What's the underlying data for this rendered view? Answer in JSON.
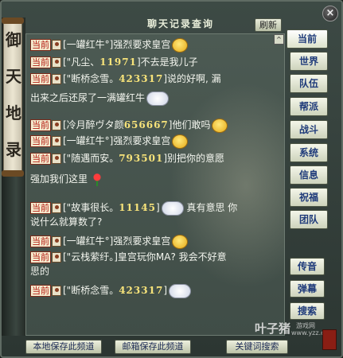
{
  "window": {
    "title": "聊天记录查询",
    "refresh_label": "刷新",
    "close_label": "×"
  },
  "scroll_deco": {
    "glyphs": [
      "御",
      "天",
      "地",
      "录"
    ]
  },
  "chat": {
    "scroll_up_label": "^",
    "messages": [
      {
        "tag": "当前",
        "parts": [
          {
            "t": "text",
            "v": "[一罐红牛°]强烈要求皇宫"
          },
          {
            "t": "emo",
            "v": "face"
          }
        ]
      },
      {
        "tag": "当前",
        "parts": [
          {
            "t": "text",
            "v": "[\"凡尘、"
          },
          {
            "t": "num",
            "v": "11971"
          },
          {
            "t": "text",
            "v": "]不去是我儿子"
          }
        ]
      },
      {
        "tag": "当前",
        "parts": [
          {
            "t": "text",
            "v": "[\"断桥念雪。"
          },
          {
            "t": "num",
            "v": "423317"
          },
          {
            "t": "text",
            "v": "]说的好啊, 漏"
          }
        ]
      },
      {
        "tag": "",
        "parts": [
          {
            "t": "text",
            "v": "出来之后还尿了一满罐红牛"
          },
          {
            "t": "emo",
            "v": "cloud"
          }
        ]
      },
      {
        "tag": "当前",
        "parts": [
          {
            "t": "text",
            "v": "[冷月醉ヴタ颜"
          },
          {
            "t": "num",
            "v": "656667"
          },
          {
            "t": "text",
            "v": "]他们敢吗"
          },
          {
            "t": "emo",
            "v": "face"
          }
        ]
      },
      {
        "tag": "当前",
        "parts": [
          {
            "t": "text",
            "v": "[一罐红牛°]强烈要求皇宫"
          },
          {
            "t": "emo",
            "v": "face"
          }
        ]
      },
      {
        "tag": "当前",
        "parts": [
          {
            "t": "text",
            "v": "[\"随遇而安。"
          },
          {
            "t": "num",
            "v": "793501"
          },
          {
            "t": "text",
            "v": "]别把你的意愿"
          }
        ]
      },
      {
        "tag": "",
        "parts": [
          {
            "t": "text",
            "v": "强加我们这里"
          },
          {
            "t": "emo",
            "v": "rose"
          }
        ]
      },
      {
        "tag": "当前",
        "parts": [
          {
            "t": "text",
            "v": "[\"故事很长。"
          },
          {
            "t": "num",
            "v": "11145"
          },
          {
            "t": "text",
            "v": "]"
          },
          {
            "t": "emo",
            "v": "cloud"
          },
          {
            "t": "text",
            "v": " 真有意思 你"
          }
        ]
      },
      {
        "tag": "",
        "parts": [
          {
            "t": "text",
            "v": "说什么就算数了?"
          }
        ]
      },
      {
        "tag": "当前",
        "parts": [
          {
            "t": "text",
            "v": "[一罐红牛°]强烈要求皇宫"
          },
          {
            "t": "emo",
            "v": "face"
          }
        ]
      },
      {
        "tag": "当前",
        "parts": [
          {
            "t": "text",
            "v": "[\"云栈萦纡。]皇宫玩你MA? 我会不好意"
          }
        ]
      },
      {
        "tag": "",
        "parts": [
          {
            "t": "text",
            "v": "思的"
          }
        ]
      },
      {
        "tag": "当前",
        "parts": [
          {
            "t": "text",
            "v": "[\"断桥念雪。"
          },
          {
            "t": "num",
            "v": "423317"
          },
          {
            "t": "text",
            "v": "]"
          },
          {
            "t": "emo",
            "v": "cloud"
          }
        ]
      }
    ]
  },
  "channels": {
    "current": "当前",
    "world": "世界",
    "team": "队伍",
    "guild": "帮派",
    "battle": "战斗",
    "system": "系统",
    "info": "信息",
    "blessing": "祝福",
    "group": "团队",
    "relay": "传音",
    "barrage": "弹幕",
    "search": "搜索"
  },
  "bottom": {
    "save_local": "本地保存此频道",
    "save_mail": "邮箱保存此频道",
    "keyword_search": "关键词搜索"
  },
  "watermark": {
    "brand": "叶子猪",
    "sub": "游戏网",
    "url": "www.yzz.cn"
  }
}
